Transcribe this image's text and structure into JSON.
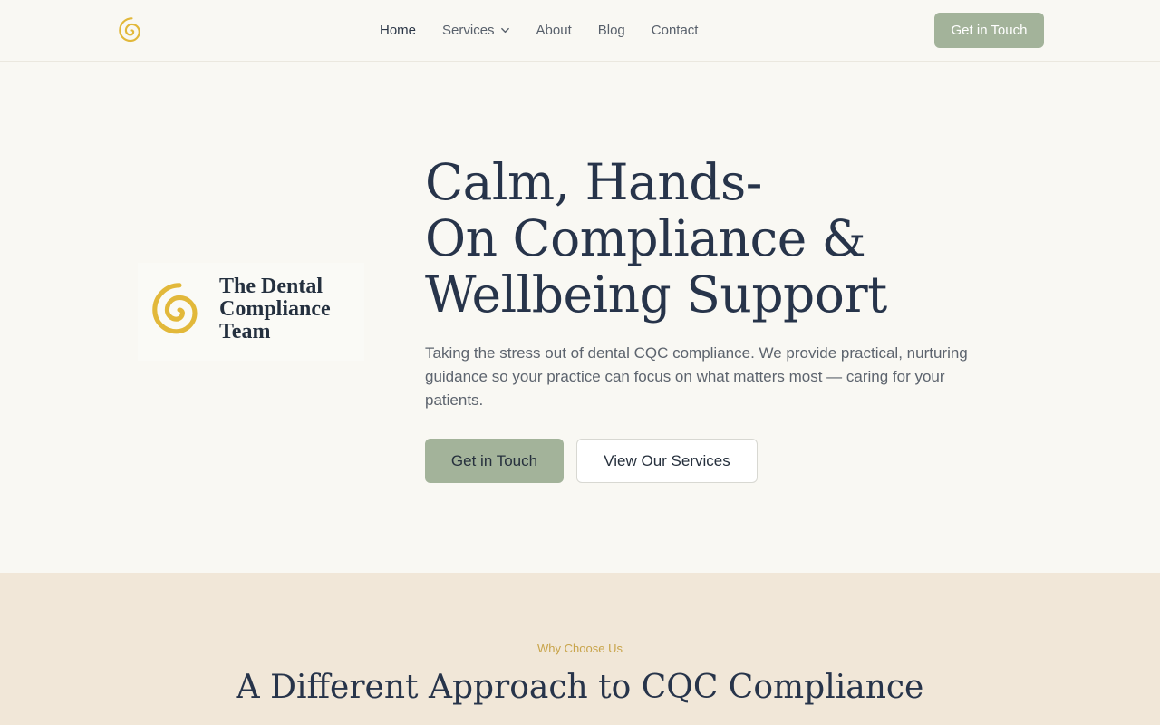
{
  "header": {
    "nav": [
      {
        "label": "Home",
        "active": true
      },
      {
        "label": "Services",
        "has_dropdown": true
      },
      {
        "label": "About"
      },
      {
        "label": "Blog"
      },
      {
        "label": "Contact"
      }
    ],
    "cta_label": "Get in Touch",
    "logo_icon": "spiral-logo-icon"
  },
  "hero": {
    "brand_lines": [
      "The Dental",
      "Compliance",
      "Team"
    ],
    "title_lines": [
      "Calm, Hands-",
      "On Compliance &",
      "Wellbeing Support"
    ],
    "description": "Taking the stress out of dental CQC compliance. We provide practical, nurturing guidance so your practice can focus on what matters most — caring for your patients.",
    "primary_button": "Get in Touch",
    "secondary_button": "View Our Services"
  },
  "why": {
    "eyebrow": "Why Choose Us",
    "title": "A Different Approach to CQC Compliance"
  },
  "colors": {
    "accent_sage": "#a3b39a",
    "spiral_gold": "#e2b83a",
    "heading_navy": "#27344a",
    "page_bg": "#f9f8f3",
    "section_bg": "#f1e7d8"
  }
}
